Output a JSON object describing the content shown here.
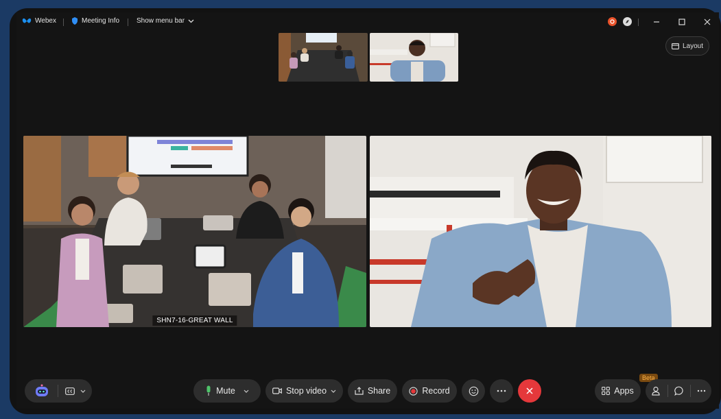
{
  "titlebar": {
    "app_name": "Webex",
    "meeting_info": "Meeting Info",
    "show_menu_bar": "Show menu bar"
  },
  "layout_button": "Layout",
  "participants": [
    {
      "name": "SHN7-16-GREAT WALL"
    },
    {
      "name": ""
    }
  ],
  "controls": {
    "mute": "Mute",
    "stop_video": "Stop video",
    "share": "Share",
    "record": "Record",
    "apps": "Apps",
    "apps_badge": "Beta"
  },
  "colors": {
    "end_call": "#e5383b",
    "record_dot": "#e5383b",
    "mic_green": "#4fc46a",
    "status_orange": "#e8522a",
    "webex_blue": "#1b8ff0"
  }
}
